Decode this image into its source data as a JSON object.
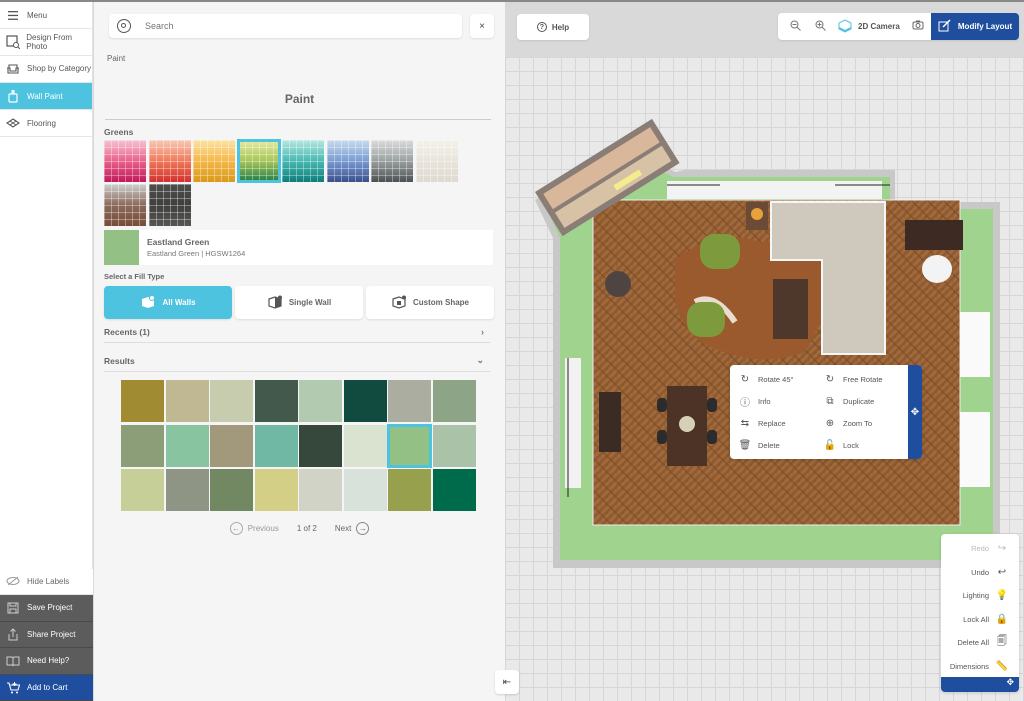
{
  "nav": {
    "items": [
      {
        "label": "Menu",
        "icon": "menu-icon"
      },
      {
        "label": "Design From Photo",
        "icon": "photo-icon"
      },
      {
        "label": "Shop by Category",
        "icon": "sofa-icon"
      },
      {
        "label": "Wall Paint",
        "icon": "paint-bucket-icon",
        "active": true
      },
      {
        "label": "Flooring",
        "icon": "flooring-icon"
      }
    ],
    "bottom": [
      {
        "label": "Hide Labels",
        "icon": "eye-off-icon"
      },
      {
        "label": "Save Project",
        "icon": "save-icon"
      },
      {
        "label": "Share Project",
        "icon": "share-icon"
      },
      {
        "label": "Need Help?",
        "icon": "book-icon"
      },
      {
        "label": "Add to Cart",
        "icon": "cart-icon"
      }
    ]
  },
  "panel": {
    "search_placeholder": "Search",
    "close_label": "×",
    "breadcrumb": "Paint",
    "title": "Paint",
    "group_label": "Greens",
    "palettes": [
      {
        "name": "Reds/Pinks",
        "colors": [
          "#f6c4d4",
          "#e8628a",
          "#c2185b"
        ]
      },
      {
        "name": "Oranges",
        "colors": [
          "#f8c9b5",
          "#ef7a5a",
          "#d32f2f"
        ]
      },
      {
        "name": "Yellows",
        "colors": [
          "#fbe3a3",
          "#f5b748",
          "#d99a1a"
        ]
      },
      {
        "name": "Greens",
        "colors": [
          "#e6eba0",
          "#a8c55a",
          "#1e7c45"
        ],
        "selected": true
      },
      {
        "name": "Teals",
        "colors": [
          "#b7e7e1",
          "#48b9b2",
          "#0d7d78"
        ]
      },
      {
        "name": "Blues/Purples",
        "colors": [
          "#c8dcef",
          "#7a9bd0",
          "#3a4f8e"
        ]
      },
      {
        "name": "Grays",
        "colors": [
          "#dcdcdc",
          "#9aa0a0",
          "#4b5152"
        ]
      },
      {
        "name": "Whites",
        "colors": [
          "#f3f1ea",
          "#e8e4dc",
          "#dedad0"
        ]
      },
      {
        "name": "Brick",
        "colors": [
          "#cfcfcf",
          "#8a6a5a",
          "#7a4b3a"
        ]
      },
      {
        "name": "Chevron",
        "colors": [
          "#4e4e4c",
          "#3f3f3d",
          "#555553"
        ]
      }
    ],
    "selected_color": {
      "name": "Eastland Green",
      "detail": "Eastland Green | HGSW1264",
      "hex": "#93c185"
    },
    "fill_type_label": "Select a Fill Type",
    "fill_types": [
      {
        "label": "All Walls",
        "active": true
      },
      {
        "label": "Single Wall",
        "active": false
      },
      {
        "label": "Custom Shape",
        "active": false
      }
    ],
    "recents_label": "Recents (1)",
    "results_label": "Results",
    "results": [
      "#a08a32",
      "#bfb892",
      "#c8ccae",
      "#43594c",
      "#b2cbb0",
      "#114a3f",
      "#abada0",
      "#8ea487",
      "#8c9e78",
      "#88c4a0",
      "#a2987c",
      "#70b8a4",
      "#36473c",
      "#d9e3cf",
      "#93c185",
      "#aac3a8",
      "#c6cf98",
      "#8e9584",
      "#728862",
      "#d3cf87",
      "#d1d3c7",
      "#d9e2da",
      "#97a04c",
      "#006b4b"
    ],
    "selected_result_index": 14,
    "pagination": {
      "previous": "Previous",
      "page": "1 of 2",
      "next": "Next"
    }
  },
  "canvas": {
    "help_label": "Help",
    "camera_label": "2D Camera",
    "modify_label": "Modify Layout",
    "context_menu": [
      {
        "label": "Rotate 45°",
        "icon": "rotate-45-icon"
      },
      {
        "label": "Free Rotate",
        "icon": "free-rotate-icon"
      },
      {
        "label": "Info",
        "icon": "info-icon"
      },
      {
        "label": "Duplicate",
        "icon": "duplicate-icon"
      },
      {
        "label": "Replace",
        "icon": "replace-icon"
      },
      {
        "label": "Zoom To",
        "icon": "zoom-to-icon"
      },
      {
        "label": "Delete",
        "icon": "trash-icon"
      },
      {
        "label": "Lock",
        "icon": "lock-icon"
      }
    ],
    "right_tools": [
      {
        "label": "Redo",
        "icon": "redo-icon",
        "disabled": true
      },
      {
        "label": "Undo",
        "icon": "undo-icon"
      },
      {
        "label": "Lighting",
        "icon": "lighting-icon"
      },
      {
        "label": "Lock All",
        "icon": "lock-all-icon"
      },
      {
        "label": "Delete All",
        "icon": "delete-all-icon"
      },
      {
        "label": "Dimensions",
        "icon": "ruler-icon"
      }
    ],
    "wall_color": "#9fd38e",
    "accent": "#1f4e9e",
    "highlight": "#4dc3df"
  }
}
